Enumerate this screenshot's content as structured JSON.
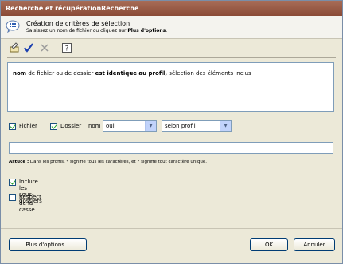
{
  "window": {
    "title": "Recherche et récupérationRecherche"
  },
  "header": {
    "title": "Création de critères de sélection",
    "subtitle_prefix": "Saisissez un nom de fichier ou cliquez sur ",
    "subtitle_bold": "Plus d'options",
    "subtitle_suffix": "."
  },
  "toolbar": {
    "icons": [
      "edit-icon",
      "check-icon",
      "delete-icon",
      "help-icon"
    ]
  },
  "description": {
    "part1": "nom",
    "part2": " de fichier ou de dossier ",
    "part3": "est identique au profil,",
    "part4": " sélection des éléments inclus"
  },
  "criteria": {
    "fichier_label": "Fichier",
    "dossier_label": "Dossier",
    "nom_label": "nom",
    "oui_value": "oui",
    "profil_value": "selon profil"
  },
  "name_input": {
    "value": ""
  },
  "tip": {
    "label": "Astuce :",
    "text": " Dans les profils, * signifie tous les caractères, et ? signifie tout caractère unique."
  },
  "options": {
    "subfolders_label": "Inclure les sous-dossiers",
    "case_label": "Respect de la casse"
  },
  "buttons": {
    "more": "Plus d'options...",
    "ok": "OK",
    "cancel": "Annuler"
  },
  "colors": {
    "titlebar": "#8a4a36",
    "header_bg": "#f4f3ee",
    "window_bg": "#ece9d8"
  }
}
